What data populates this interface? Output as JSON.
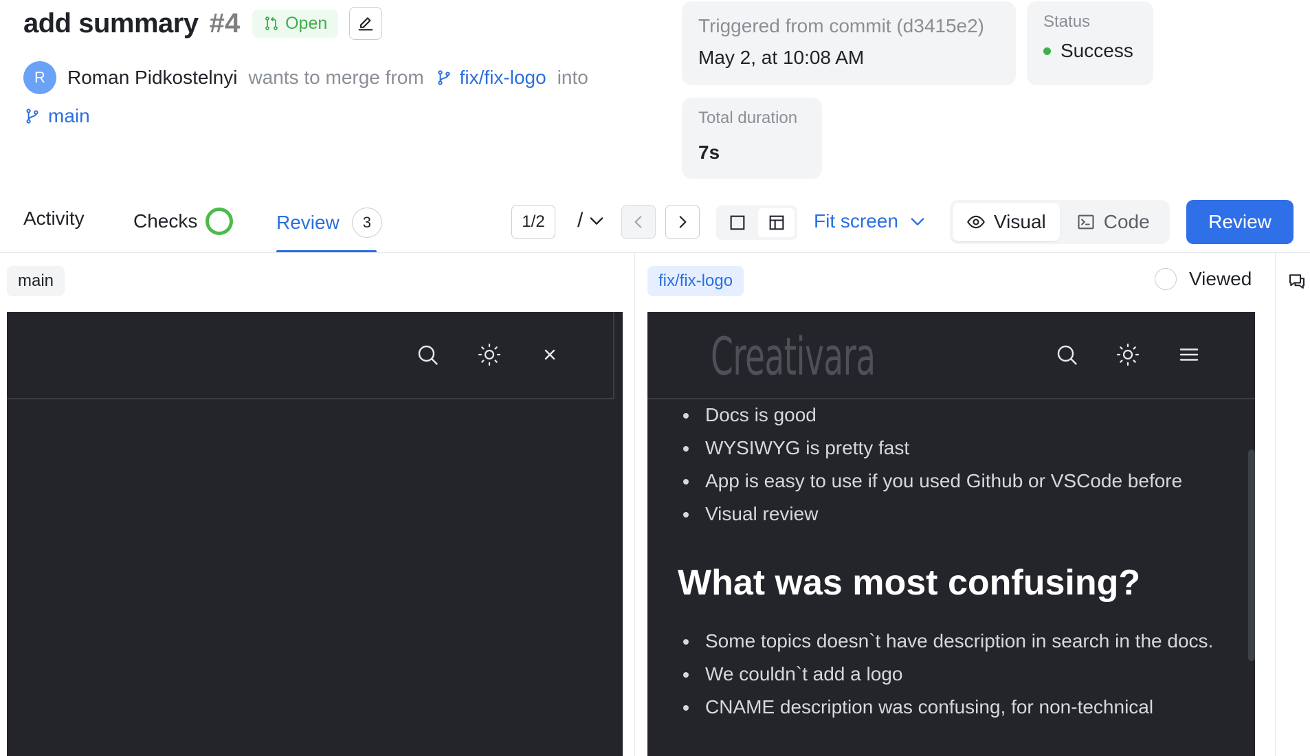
{
  "header": {
    "title": "add summary",
    "number": "#4",
    "status_badge": "Open",
    "author_initial": "R",
    "author": "Roman Pidkostelnyi",
    "merge_text": "wants to merge from",
    "source_branch": "fix/fix-logo",
    "into_text": "into",
    "target_branch": "main"
  },
  "cards": {
    "commit_label": "Triggered from commit (d3415e2)",
    "commit_time": "May 2, at 10:08 AM",
    "status_label": "Status",
    "status_value": "Success",
    "duration_label": "Total duration",
    "duration_value": "7s"
  },
  "tabs": {
    "activity": "Activity",
    "checks": "Checks",
    "review": "Review",
    "review_count": "3"
  },
  "toolbar": {
    "page_indicator": "1/2",
    "slash": "/",
    "fit_screen": "Fit screen",
    "visual": "Visual",
    "code": "Code",
    "review_button": "Review"
  },
  "left_panel": {
    "branch": "main"
  },
  "right_panel": {
    "branch": "fix/fix-logo",
    "viewed": "Viewed",
    "logo_text": "Creativara",
    "list1": [
      "Docs is good",
      "WYSIWYG is pretty fast",
      "App is easy to use if you used Github or VSCode before",
      "Visual review"
    ],
    "heading": "What was most confusing?",
    "list2": [
      "Some topics doesn`t have description in search in the docs.",
      "We couldn`t add a logo",
      "CNAME description was confusing, for non-technical"
    ]
  },
  "colors": {
    "accent": "#2b6fe0",
    "success": "#3fae4b",
    "preview_bg": "#24252a"
  }
}
